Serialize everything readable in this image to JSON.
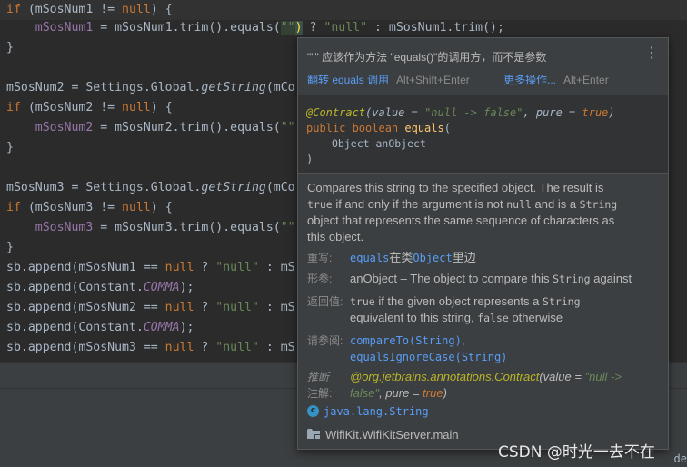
{
  "editor": {
    "lines": [
      {
        "top": 0,
        "highlight": true
      },
      {},
      {},
      {},
      {},
      {},
      {},
      {},
      {},
      {},
      {},
      {},
      {},
      {},
      {},
      {},
      {},
      {}
    ],
    "code": {
      "l1_kw_if": "if",
      "l1_rest": " (mSosNum1 != ",
      "l1_null": "null",
      "l1_end": ") {",
      "l2_indent": "    ",
      "l2_var": "mSosNum1",
      "l2_mid": " = mSosNum1.trim().equals(",
      "l2_emptystr": "\"\"",
      "l2_close": ")",
      "l2_q": " ? ",
      "l2_nullstr": "\"null\"",
      "l2_colon": " : ",
      "l2_trim": "mSosNum1.trim();",
      "l3": "}",
      "l5_a": "mSosNum2 = Settings.Global.",
      "l5_method": "getString",
      "l5_b": "(mCo",
      "l6_kw_if": "if",
      "l6_rest": " (mSosNum2 != ",
      "l6_null": "null",
      "l6_end": ") {",
      "l7_var": "mSosNum2",
      "l7_mid": " = mSosNum2.trim().equals(",
      "l7_str": "\"\"",
      "l8": "}",
      "l10_a": "mSosNum3 = Settings.Global.",
      "l10_method": "getString",
      "l10_b": "(mCo",
      "l11_kw_if": "if",
      "l11_rest": " (mSosNum3 != ",
      "l11_null": "null",
      "l11_end": ") {",
      "l12_var": "mSosNum3",
      "l12_mid": " = mSosNum3.trim().equals(",
      "l12_str": "\"\"",
      "l13": "}",
      "l14_a": "sb.append(mSosNum1 == ",
      "l14_null": "null",
      "l14_q": " ? ",
      "l14_str": "\"null\"",
      "l14_b": " : mS",
      "l15_a": "sb.append(Constant.",
      "l15_const": "COMMA",
      "l15_b": ");",
      "l16_a": "sb.append(mSosNum2 == ",
      "l16_null": "null",
      "l16_q": " ? ",
      "l16_str": "\"null\"",
      "l16_b": " : mS",
      "l17_a": "sb.append(Constant.",
      "l17_const": "COMMA",
      "l17_b": ");",
      "l18_a": "sb.append(mSosNum3 == ",
      "l18_null": "null",
      "l18_q": " ? ",
      "l18_str": "\"null\"",
      "l18_b": " : mS"
    },
    "right_edge_text": "de"
  },
  "popup": {
    "warning": "\"\"\" 应该作为方法 \"equals()\"的调用方，而不是参数",
    "action_flip": "翻转 equals 调用",
    "action_flip_shortcut": "Alt+Shift+Enter",
    "action_more": "更多操作...",
    "action_more_shortcut": "Alt+Enter",
    "more_menu": "⋮",
    "signature": {
      "annotation": "@Contract",
      "ann_open": "(",
      "ann_value_key": "value",
      "ann_eq1": " = ",
      "ann_value": "\"null -> false\"",
      "ann_comma": ", ",
      "ann_pure_key": "pure",
      "ann_eq2": " = ",
      "ann_pure": "true",
      "ann_close": ")",
      "modifiers": "public boolean ",
      "method": "equals",
      "open": "(",
      "param_type": "Object",
      "param_name": " anObject",
      "close": ")"
    },
    "description": {
      "p1": "Compares this string to the specified object. The result is",
      "p2_mono1": "true",
      "p2_a": " if and only if the argument is not ",
      "p2_mono2": "null",
      "p2_b": " and is a ",
      "p2_mono3": "String",
      "p3": "object that represents the same sequence of characters as",
      "p4": "this object."
    },
    "overrides_label": "重写:",
    "overrides_method": "equals",
    "overrides_mid": "在类",
    "overrides_class": "Object",
    "overrides_end": "里边",
    "params_label": "形参:",
    "params_text_a": "anObject – The object to compare this ",
    "params_mono": "String",
    "params_text_b": " against",
    "returns_label": "返回值:",
    "returns_mono1": "true",
    "returns_a": " if the given object represents a ",
    "returns_mono2": "String",
    "returns_b": "equivalent to this string, ",
    "returns_mono3": "false",
    "returns_c": " otherwise",
    "see_label": "请参阅:",
    "see_1": "compareTo(String)",
    "see_comma": ",",
    "see_2": "equalsIgnoreCase(String)",
    "inferred_label1": "推断",
    "inferred_label2": "注解:",
    "inferred_ann": "@org.jetbrains.annotations.Contract",
    "inferred_open": "(",
    "inferred_value_key": "value",
    "inferred_eq": " = ",
    "inferred_value": "\"null ->",
    "inferred_value2": "false\"",
    "inferred_comma": ", ",
    "inferred_pure_key": "pure",
    "inferred_eq2": " = ",
    "inferred_pure": "true",
    "inferred_close": ")",
    "class_icon": "c",
    "class_name": "java.lang.String",
    "module_name": "WifiKit.WifiKitServer.main"
  },
  "watermark": "CSDN @时光一去不在",
  "colors": {
    "editor_bg": "#2b2b2b",
    "popup_bg": "#3c3f41",
    "keyword": "#cc7832",
    "string": "#6a8759",
    "link": "#589df6"
  }
}
